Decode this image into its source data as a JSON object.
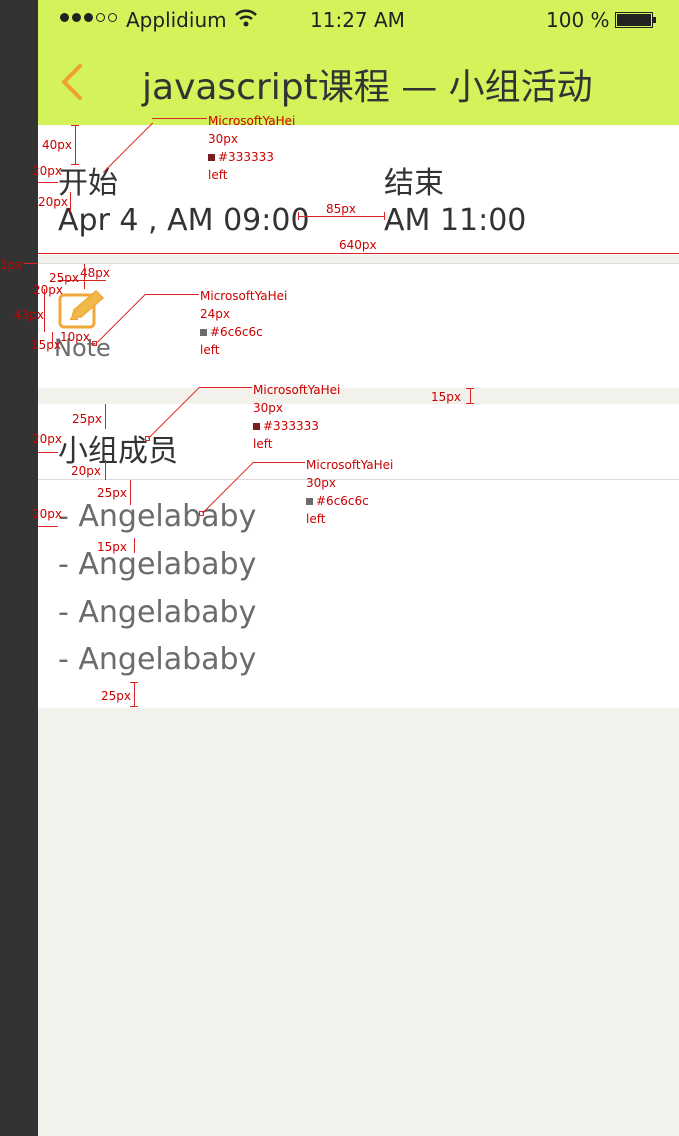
{
  "status": {
    "carrier": "Applidium",
    "time": "11:27 AM",
    "battery": "100 %"
  },
  "nav": {
    "title": "javascript课程 — 小组活动"
  },
  "time": {
    "start_label": "开始",
    "end_label": "结束",
    "start_value": "Apr 4 , AM 09:00",
    "end_value": "AM 11:00"
  },
  "note": {
    "label": "Note"
  },
  "members": {
    "title": "小组成员",
    "items": [
      "- Angelababy",
      "- Angelababy",
      "- Angelababy",
      "- Angelababy"
    ]
  },
  "annotations": {
    "m40": "40px",
    "m20a": "20px",
    "m20b": "20px",
    "m85": "85px",
    "m640": "640px",
    "m1": "1px",
    "m48": "48px",
    "m25a": "25px",
    "m20c": "20px",
    "m43": "43px",
    "m15a": "15px",
    "m10": "10px",
    "m15b": "15px",
    "m25b": "25px",
    "m20d": "20px",
    "m20e": "20px",
    "m25c": "25px",
    "m20f": "20px",
    "m15c": "15px",
    "m25d": "25px",
    "spec1": {
      "font": "MicrosoftYaHei",
      "size": "30px",
      "color": "#333333",
      "align": "left"
    },
    "spec2": {
      "font": "MicrosoftYaHei",
      "size": "24px",
      "color": "#6c6c6c",
      "align": "left"
    },
    "spec3": {
      "font": "MicrosoftYaHei",
      "size": "30px",
      "color": "#333333",
      "align": "left"
    },
    "spec4": {
      "font": "MicrosoftYaHei",
      "size": "30px",
      "color": "#6c6c6c",
      "align": "left"
    }
  },
  "colors": {
    "accent": "#d4f25a",
    "back_arrow": "#f0a030",
    "text_dark": "#333333",
    "text_gray": "#6c6c6c",
    "annotation": "#cc0000"
  }
}
